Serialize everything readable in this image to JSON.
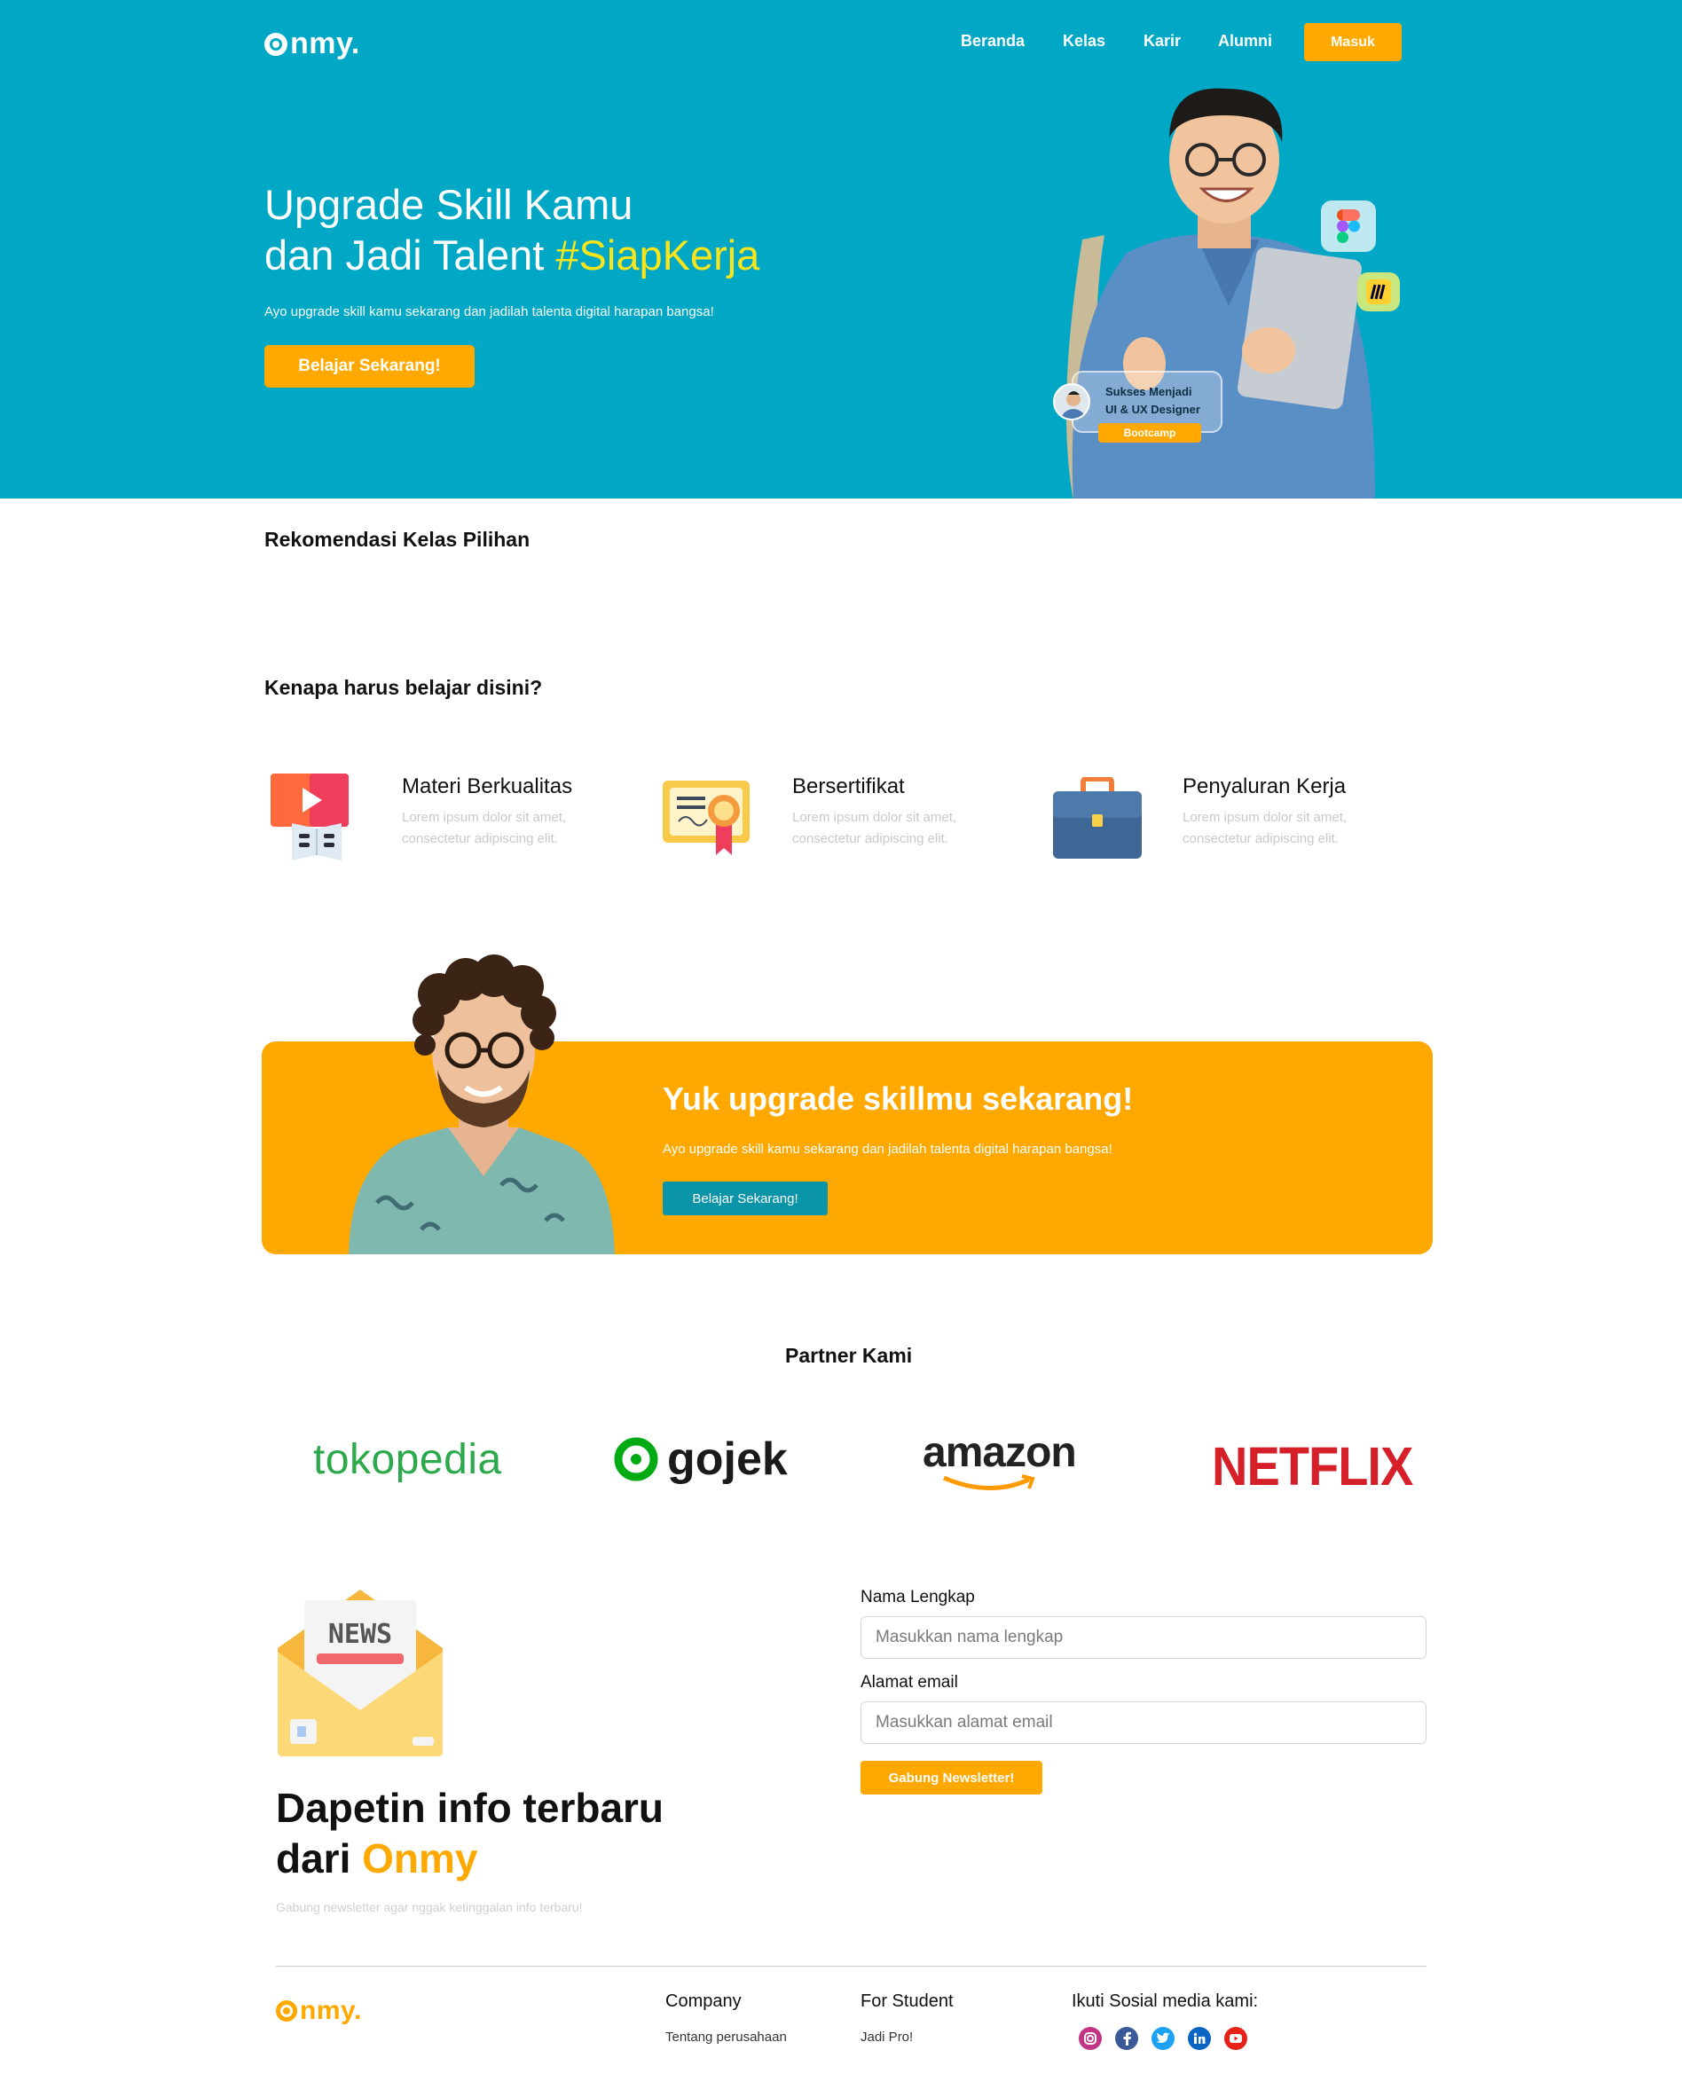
{
  "brand": {
    "name": "nmy.",
    "full": "Onmy",
    "color": "#00a8c6",
    "accent": "#ffa900",
    "highlight": "#f9e51a"
  },
  "nav": {
    "items": [
      "Beranda",
      "Kelas",
      "Karir",
      "Alumni"
    ],
    "login": "Masuk"
  },
  "hero": {
    "title_line1": "Upgrade Skill Kamu",
    "title_line2_prefix": "dan Jadi Talent ",
    "title_highlight": "#SiapKerja",
    "subtitle": "Ayo upgrade skill kamu sekarang dan jadilah talenta digital harapan bangsa!",
    "cta": "Belajar Sekarang!",
    "badge_line1": "Sukses Menjadi",
    "badge_line2": "UI & UX Designer",
    "badge_tag": "Bootcamp",
    "icons": [
      "figma-icon",
      "miro-icon"
    ]
  },
  "recommend": {
    "title": "Rekomendasi Kelas Pilihan"
  },
  "why": {
    "title": "Kenapa harus belajar disini?",
    "features": [
      {
        "icon": "video-book-icon",
        "title": "Materi Berkualitas",
        "desc": "Lorem ipsum dolor sit amet, consectetur adipiscing elit."
      },
      {
        "icon": "certificate-icon",
        "title": "Bersertifikat",
        "desc": "Lorem ipsum dolor sit amet, consectetur adipiscing elit."
      },
      {
        "icon": "briefcase-icon",
        "title": "Penyaluran Kerja",
        "desc": "Lorem ipsum dolor sit amet, consectetur adipiscing elit."
      }
    ]
  },
  "cta": {
    "title": "Yuk upgrade skillmu sekarang!",
    "subtitle": "Ayo upgrade skill kamu sekarang dan jadilah talenta digital harapan bangsa!",
    "button": "Belajar Sekarang!"
  },
  "partners": {
    "title": "Partner Kami",
    "logos": [
      "tokopedia",
      "gojek",
      "amazon",
      "NETFLIX"
    ]
  },
  "newsletter": {
    "icon_text": "NEWS",
    "title_line1": "Dapetin info terbaru",
    "title_line2_prefix": "dari ",
    "title_highlight": "Onmy",
    "subtitle": "Gabung newsletter agar nggak ketinggalan info terbaru!",
    "name_label": "Nama Lengkap",
    "name_placeholder": "Masukkan nama lengkap",
    "email_label": "Alamat email",
    "email_placeholder": "Masukkan alamat email",
    "button": "Gabung Newsletter!"
  },
  "footer": {
    "company_head": "Company",
    "company_link": "Tentang perusahaan",
    "student_head": "For Student",
    "student_link": "Jadi Pro!",
    "social_head": "Ikuti Sosial media kami:",
    "socials": [
      {
        "icon": "instagram-icon",
        "color": "#c13584"
      },
      {
        "icon": "facebook-icon",
        "color": "#3b5998"
      },
      {
        "icon": "twitter-icon",
        "color": "#1da1f2"
      },
      {
        "icon": "linkedin-icon",
        "color": "#0a66c2"
      },
      {
        "icon": "youtube-icon",
        "color": "#e62117"
      }
    ]
  }
}
